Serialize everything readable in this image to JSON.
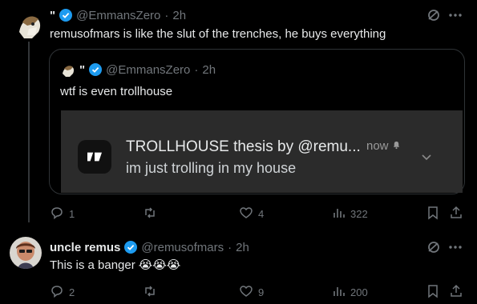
{
  "post1": {
    "display_name": "\"",
    "handle": "@EmmansZero",
    "separator": "·",
    "time": "2h",
    "text": "remusofmars is like the slut of the trenches, he buys everything",
    "quote": {
      "display_name": "\"",
      "handle": "@EmmansZero",
      "separator": "·",
      "time": "2h",
      "text": "wtf is even trollhouse",
      "notification": {
        "title": "TROLLHOUSE thesis by @remu...",
        "time": "now",
        "body": "im just trolling in my house"
      }
    },
    "actions": {
      "replies": "1",
      "likes": "4",
      "views": "322"
    }
  },
  "post2": {
    "display_name": "uncle remus",
    "handle": "@remusofmars",
    "separator": "·",
    "time": "2h",
    "text": "This is a banger",
    "emojis": "😭😭😭",
    "actions": {
      "replies": "2",
      "likes": "9",
      "views": "200"
    }
  },
  "colors": {
    "background": "#000000",
    "muted": "#71767b",
    "verified": "#1d9bf0",
    "card": "#2b2b2b"
  }
}
